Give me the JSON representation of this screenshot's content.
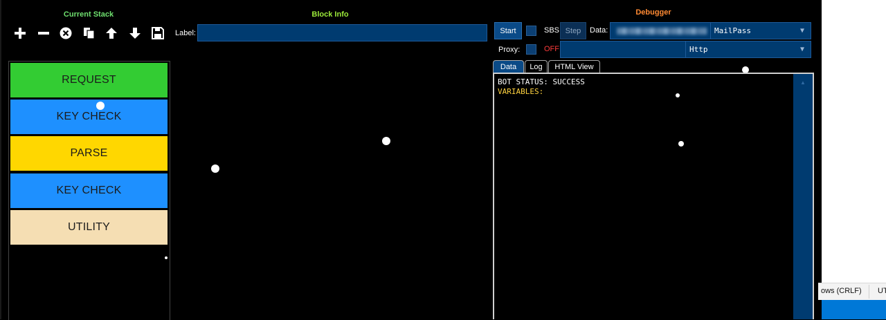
{
  "sections": {
    "current_stack": "Current Stack",
    "block_info": "Block Info",
    "debugger": "Debugger"
  },
  "toolbar": {
    "icons": [
      "add-icon",
      "remove-icon",
      "clear-icon",
      "clone-icon",
      "move-up-icon",
      "move-down-icon",
      "save-icon"
    ]
  },
  "blocks": [
    {
      "label": "REQUEST",
      "color": "#33cc33"
    },
    {
      "label": "KEY CHECK",
      "color": "#1e90ff"
    },
    {
      "label": "PARSE",
      "color": "#ffd700"
    },
    {
      "label": "KEY CHECK",
      "color": "#1e90ff"
    },
    {
      "label": "UTILITY",
      "color": "#f5deb3"
    }
  ],
  "block_info": {
    "label_caption": "Label:",
    "label_value": ""
  },
  "debugger": {
    "start_label": "Start",
    "sbs_label": "SBS",
    "step_label": "Step",
    "data_label": "Data:",
    "wordlist_type": "MailPass",
    "proxy_label": "Proxy:",
    "proxy_state": "OFF",
    "proxy_type": "Http",
    "tabs": [
      "Data",
      "Log",
      "HTML View"
    ],
    "active_tab": "Data",
    "output": {
      "line1": "BOT STATUS: SUCCESS",
      "line2": "VARIABLES:"
    }
  },
  "statusbar": {
    "line_ending": "ows (CRLF)",
    "encoding": "UT"
  },
  "colors": {
    "accent_stack": "#6fe06f",
    "accent_block": "#9cea3a",
    "accent_debugger": "#ff8a33",
    "field_bg": "#003b70",
    "proxy_off": "#ff3b3b"
  }
}
